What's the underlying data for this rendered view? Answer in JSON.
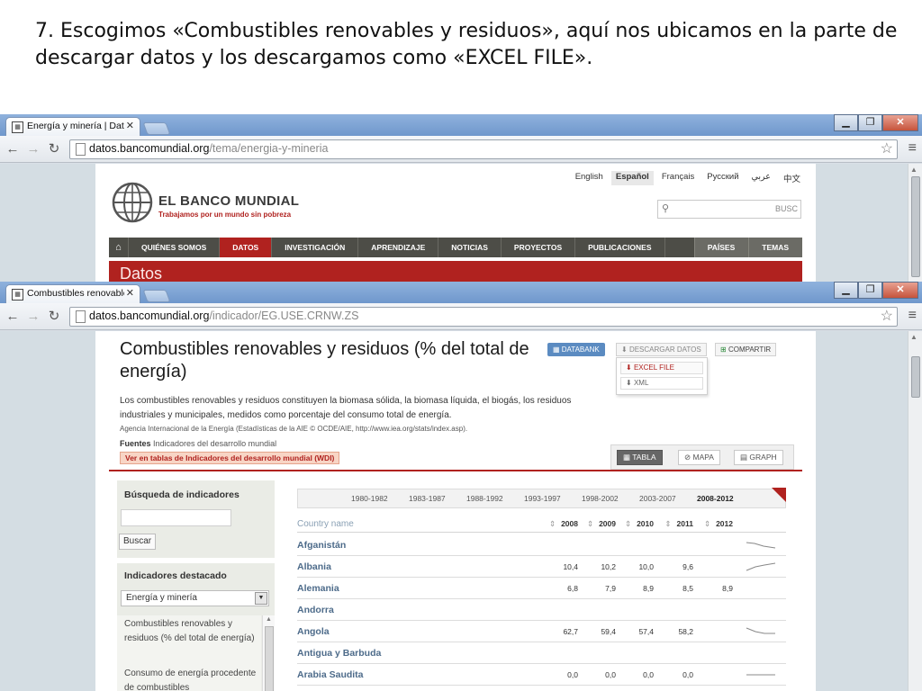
{
  "slide": {
    "caption": "7. Escogimos «Combustibles renovables y residuos», aquí nos ubicamos en la parte de descargar datos y los descargamos como «EXCEL FILE»."
  },
  "browser1": {
    "tab_title": "Energía y minería | Datos",
    "url_domain": "datos.bancomundial.org",
    "url_path": "/tema/energia-y-mineria",
    "languages": [
      "English",
      "Español",
      "Français",
      "Русский",
      "عربي",
      "中文"
    ],
    "active_language": "Español",
    "logo_name": "EL BANCO MUNDIAL",
    "logo_tagline": "Trabajamos por un mundo sin pobreza",
    "search_button": "BUSC",
    "nav": [
      "QUIÉNES SOMOS",
      "DATOS",
      "INVESTIGACIÓN",
      "APRENDIZAJE",
      "NOTICIAS",
      "PROYECTOS",
      "PUBLICACIONES"
    ],
    "nav_right": [
      "PAÍSES",
      "TEMAS"
    ],
    "banner_text": "Datos"
  },
  "browser2": {
    "tab_title": "Combustibles renovables",
    "url_domain": "datos.bancomundial.org",
    "url_path": "/indicador/EG.USE.CRNW.ZS",
    "indicator_title": "Combustibles renovables y residuos (% del total de energía)",
    "buttons": {
      "databank": "DATABANK",
      "descargar": "DESCARGAR DATOS",
      "compartir": "COMPARTIR"
    },
    "download_menu": {
      "excel": "EXCEL FILE",
      "xml": "XML"
    },
    "description": "Los combustibles renovables y residuos constituyen la biomasa sólida, la biomasa líquida, el biogás, los residuos industriales y municipales, medidos como porcentaje del consumo total de energía.",
    "source_note": "Agencia Internacional de la Energía (Estadísticas de la AIE © OCDE/AIE, http://www.iea.org/stats/index.asp).",
    "fuentes_label": "Fuentes",
    "fuentes_value": "Indicadores del desarrollo mundial",
    "wdi_link": "Ver en tablas de Indicadores del desarrollo mundial (WDI)",
    "view_tabs": [
      "TABLA",
      "MAPA",
      "GRAPH"
    ],
    "sidebar": {
      "search_heading": "Búsqueda de indicadores",
      "search_button": "Buscar",
      "featured_heading": "Indicadores destacado",
      "select_value": "Energía y minería",
      "list_items": [
        "Combustibles renovables y residuos (% del total de energía)",
        "Consumo de energía procedente de combustibles"
      ]
    },
    "periods": [
      "1980-1982",
      "1983-1987",
      "1988-1992",
      "1993-1997",
      "1998-2002",
      "2003-2007",
      "2008-2012"
    ],
    "active_period": "2008-2012",
    "table": {
      "country_header": "Country name",
      "years": [
        "2008",
        "2009",
        "2010",
        "2011",
        "2012"
      ],
      "rows": [
        {
          "country": "Afganistán",
          "values": [
            "",
            "",
            "",
            "",
            ""
          ]
        },
        {
          "country": "Albania",
          "values": [
            "10,4",
            "10,2",
            "10,0",
            "9,6",
            ""
          ]
        },
        {
          "country": "Alemania",
          "values": [
            "6,8",
            "7,9",
            "8,9",
            "8,5",
            "8,9"
          ]
        },
        {
          "country": "Andorra",
          "values": [
            "",
            "",
            "",
            "",
            ""
          ]
        },
        {
          "country": "Angola",
          "values": [
            "62,7",
            "59,4",
            "57,4",
            "58,2",
            ""
          ]
        },
        {
          "country": "Antigua y Barbuda",
          "values": [
            "",
            "",
            "",
            "",
            ""
          ]
        },
        {
          "country": "Arabia Saudita",
          "values": [
            "0,0",
            "0,0",
            "0,0",
            "0,0",
            ""
          ]
        }
      ]
    }
  },
  "colors": {
    "brand_red": "#b0221f",
    "nav_dark": "#4d4d47",
    "link_blue": "#4d6b8a",
    "databank_blue": "#5b8bc1"
  }
}
